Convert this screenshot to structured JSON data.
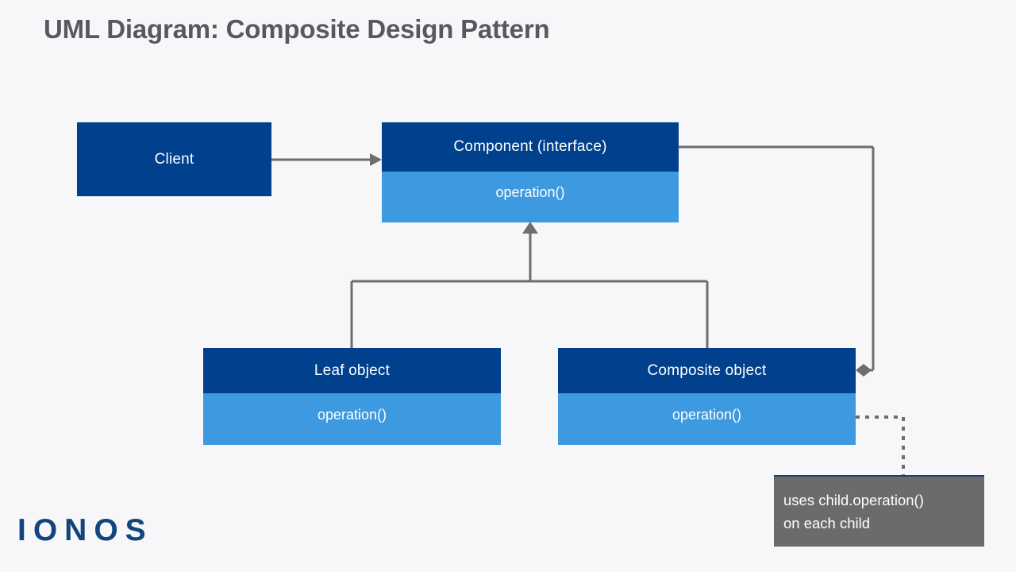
{
  "page": {
    "title": "UML Diagram: Composite Design Pattern",
    "background_color": "#f7f7f9",
    "title_color": "#565a5c"
  },
  "palette": {
    "class_header": "#00408c",
    "class_body": "#3d9ae0",
    "connector": "#6e6e6e",
    "note_background": "#6b6b6e",
    "note_border": "#1c3f70",
    "logo_blue": "#12457f",
    "text_on_fill": "#ffffff"
  },
  "diagram": {
    "type": "uml-class-diagram",
    "classes": [
      {
        "id": "client",
        "name": "Client",
        "compartments": [
          "Client"
        ],
        "operations": []
      },
      {
        "id": "component",
        "name": "Component (interface)",
        "compartments": [
          "Component (interface)",
          "operation()"
        ],
        "operations": [
          "operation()"
        ]
      },
      {
        "id": "leaf",
        "name": "Leaf object",
        "compartments": [
          "Leaf object",
          "operation()"
        ],
        "operations": [
          "operation()"
        ]
      },
      {
        "id": "composite",
        "name": "Composite object",
        "compartments": [
          "Composite object",
          "operation()"
        ],
        "operations": [
          "operation()"
        ]
      }
    ],
    "relationships": [
      {
        "from": "client",
        "to": "component",
        "kind": "association",
        "style": "solid",
        "marker": "open-arrow"
      },
      {
        "from": "leaf",
        "to": "component",
        "kind": "generalization",
        "style": "solid",
        "marker": "triangle-arrow"
      },
      {
        "from": "composite",
        "to": "component",
        "kind": "generalization",
        "style": "solid",
        "marker": "triangle-arrow"
      },
      {
        "from": "component",
        "to": "composite",
        "kind": "aggregation",
        "style": "solid",
        "marker": "diamond"
      },
      {
        "from": "composite",
        "to": "note",
        "kind": "note-link",
        "style": "dotted",
        "marker": "none"
      }
    ],
    "note": {
      "id": "note",
      "lines": [
        "uses child.operation()",
        "on each child"
      ]
    }
  },
  "branding": {
    "logo_text": "IONOS"
  }
}
